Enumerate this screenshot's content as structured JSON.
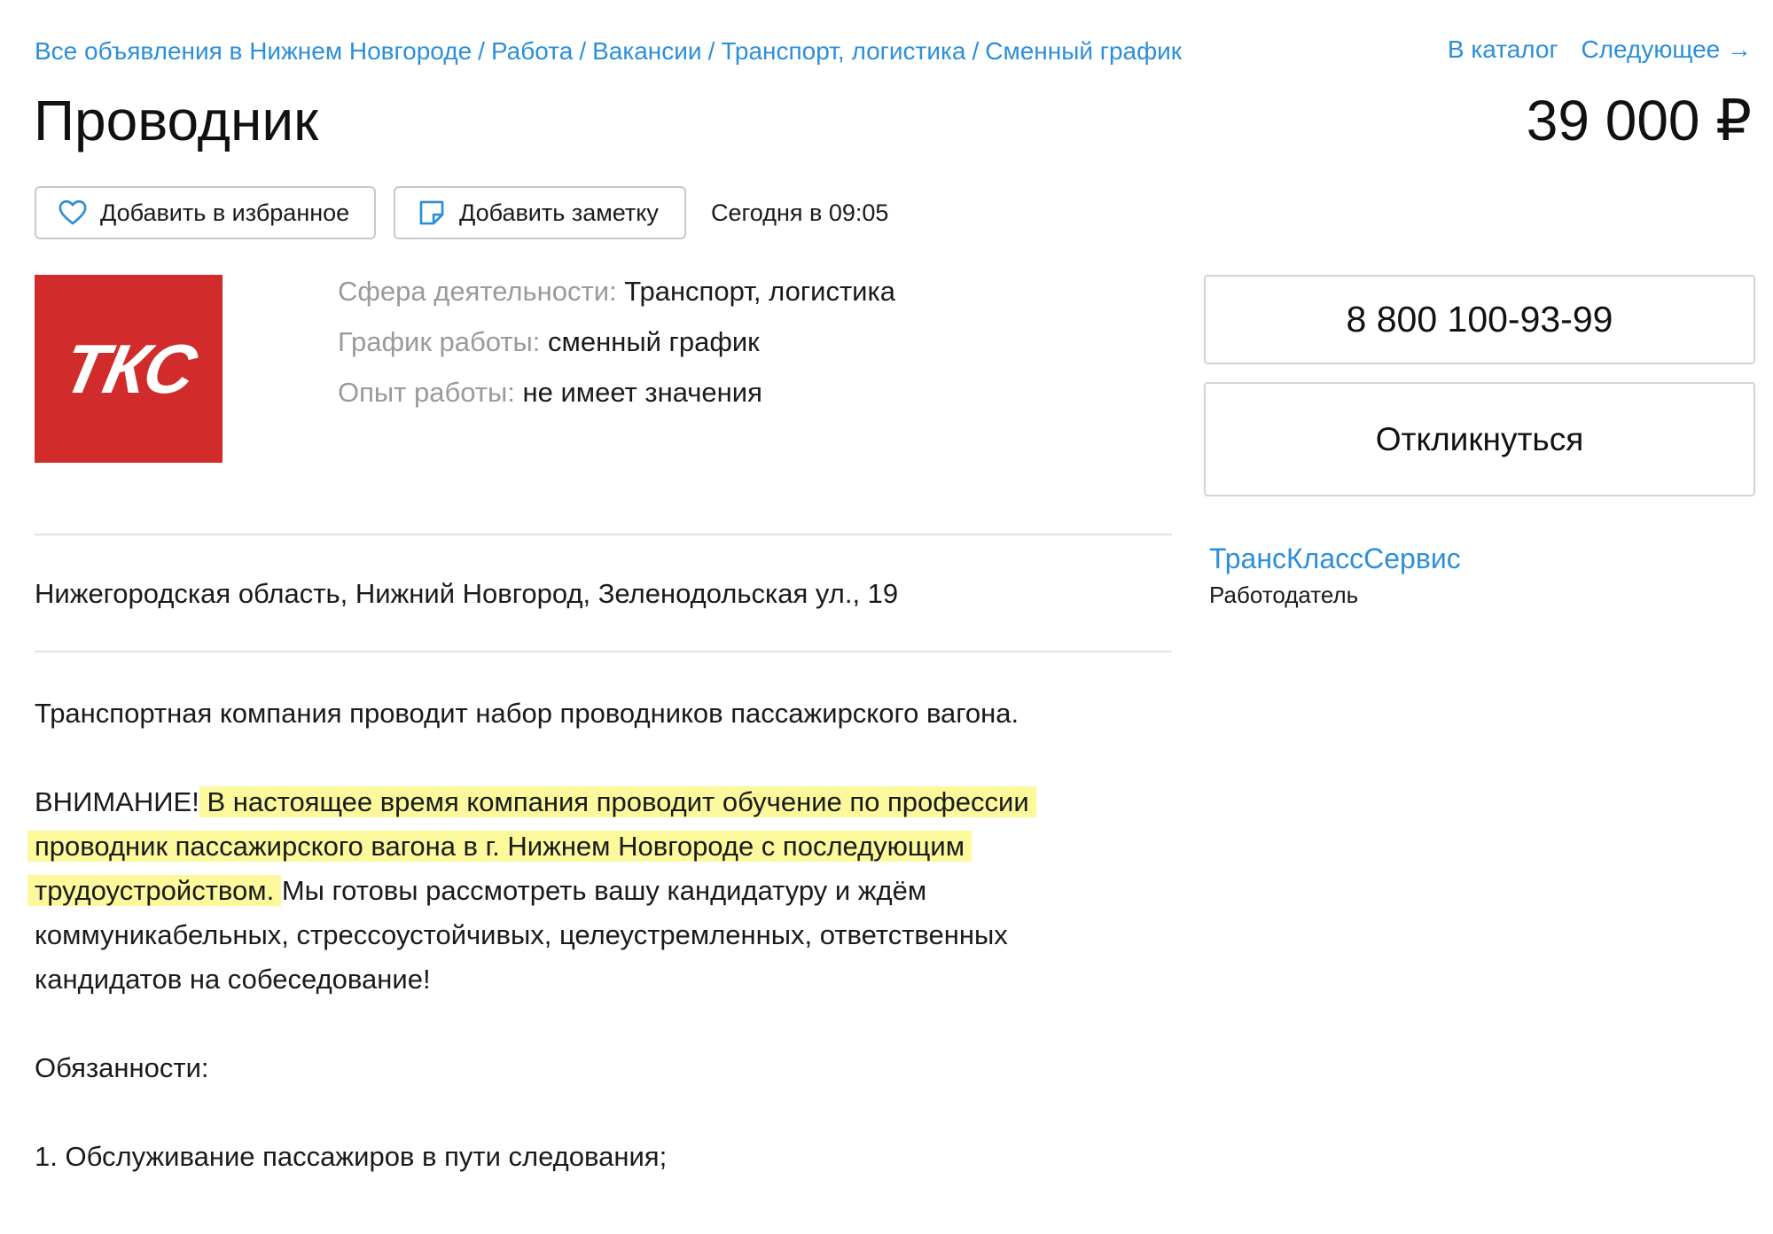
{
  "breadcrumbs": [
    {
      "label": "Все объявления в Нижнем Новгороде"
    },
    {
      "label": "Работа"
    },
    {
      "label": "Вакансии"
    },
    {
      "label": "Транспорт, логистика"
    },
    {
      "label": "Сменный график"
    }
  ],
  "breadcrumb_separator": "/",
  "topnav": {
    "catalog": "В каталог",
    "next": "Следующее →"
  },
  "listing": {
    "title": "Проводник",
    "price": "39 000 ₽",
    "posted": "Сегодня в 09:05"
  },
  "actions": {
    "favorite": "Добавить в избранное",
    "note": "Добавить заметку"
  },
  "logo": {
    "text": "ТКС",
    "bg_color": "#d12c2b"
  },
  "params": [
    {
      "key": "Сфера деятельности:",
      "value": "Транспорт, логистика"
    },
    {
      "key": "График работы:",
      "value": "сменный график"
    },
    {
      "key": "Опыт работы:",
      "value": "не имеет значения"
    }
  ],
  "contact": {
    "phone": "8 800 100-93-99",
    "reply": "Откликнуться",
    "company": "ТрансКлассСервис",
    "company_role": "Работодатель"
  },
  "address": "Нижегородская область, Нижний Новгород, Зеленодольская ул., 19",
  "description": {
    "intro": "Транспортная компания проводит набор проводников пассажирского вагона.",
    "attention_prefix": "ВНИМАНИЕ!",
    "attention_highlight": "В настоящее время компания проводит обучение по профессии проводник пассажирского вагона в г. Нижнем Новгороде с последующим трудоустройством.",
    "attention_rest": "Мы готовы рассмотреть вашу кандидатуру и ждём коммуникабельных, стрессоустойчивых, целеустремленных, ответственных кандидатов на собеседование!",
    "duties_heading": "Обязанности:",
    "duty_1": "1. Обслуживание пассажиров в пути следования;"
  },
  "colors": {
    "link": "#2c8fd8",
    "highlight": "#fbf99b",
    "muted": "#9a9a9a"
  },
  "icons": {
    "favorite": "heart-icon",
    "note": "note-icon"
  }
}
